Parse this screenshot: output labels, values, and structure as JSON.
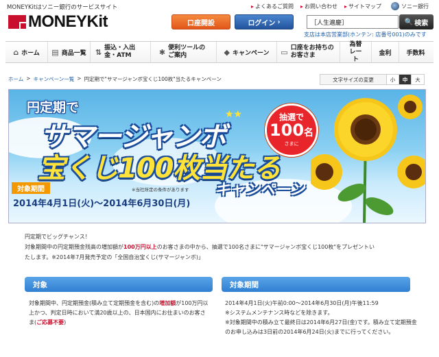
{
  "header": {
    "tagline": "MONEYKitはソニー銀行のサービスサイト",
    "logo_text": "MONEYKit",
    "top_links": [
      "よくあるご質問",
      "お問い合わせ",
      "サイトマップ"
    ],
    "sony_bank": "ソニー銀行",
    "open_account": "口座開設",
    "login": "ログイン",
    "search_value": "［人生遍慶］",
    "search_button": "検索",
    "branch_info": "支店は本店営業部(ホンテン: 店番号001)のみです"
  },
  "nav": {
    "items": [
      {
        "label": "ホーム",
        "icon": "home-icon"
      },
      {
        "label": "商品一覧",
        "icon": "document-icon"
      },
      {
        "label": "振込・入出金・ATM",
        "icon": "transfer-icon"
      },
      {
        "label": "便利ツールのご案内",
        "icon": "tools-icon"
      },
      {
        "label": "キャンペーン",
        "icon": "tag-icon"
      },
      {
        "label": "口座をお持ちのお客さま",
        "icon": "account-icon"
      },
      {
        "label": "為替レート",
        "icon": ""
      },
      {
        "label": "金利",
        "icon": ""
      },
      {
        "label": "手数料",
        "icon": ""
      }
    ]
  },
  "breadcrumb": {
    "home": "ホーム",
    "campaigns": "キャンペーン一覧",
    "current": "円定期で\"サマージャンボ宝くじ100枚\"当たるキャンペーン"
  },
  "font_size": {
    "label": "文字サイズの変更",
    "small": "小",
    "medium": "中",
    "large": "大"
  },
  "banner": {
    "line1": "円定期で",
    "line2": "サマージャンボ",
    "line3": "宝くじ100枚当たる",
    "line4": "キャンペーン",
    "badge_top": "抽選で",
    "badge_num": "100",
    "badge_unit": "名",
    "badge_bottom": "さまに",
    "period_label": "対象期間",
    "period_note": "※当社所定の条件があります",
    "period_dates": "2014年4月1日(火)～2014年6月30日(月)"
  },
  "intro": {
    "line1": "円定期でビッグチャンス！",
    "line2a": "対象期間中の円定期預金残高の増加額が",
    "line2b": "100万円以上",
    "line2c": "のお客さまの中から、抽選で100名さまに\"サマージャンボ宝くじ100枚\"をプレゼントい",
    "line3": "たします。※2014年7月発売予定の「全国自治宝くじ(サマージャンボ)」"
  },
  "section_target": {
    "title": "対象",
    "body_a": "対象期間中、円定期預金(積み立て定期預金を含む)の",
    "body_b": "増加額",
    "body_c": "が100万円以上かつ、判定日時において満20歳以上の、日本国内にお住まいのお客さま(",
    "body_d": "ご応募不要",
    "body_e": ")"
  },
  "section_period": {
    "title": "対象期間",
    "line1": "2014年4月1日(火)午前0:00～2014年6月30日(月)午後11:59",
    "line2": "※システムメンテナンス時などを除きます。",
    "line3": "※対象期間中の積み立て最終日は2014年6月27日(金)です。積み立て定期預金のお申し込みは3日前の2014年6月24日(火)までに行ってください。"
  }
}
